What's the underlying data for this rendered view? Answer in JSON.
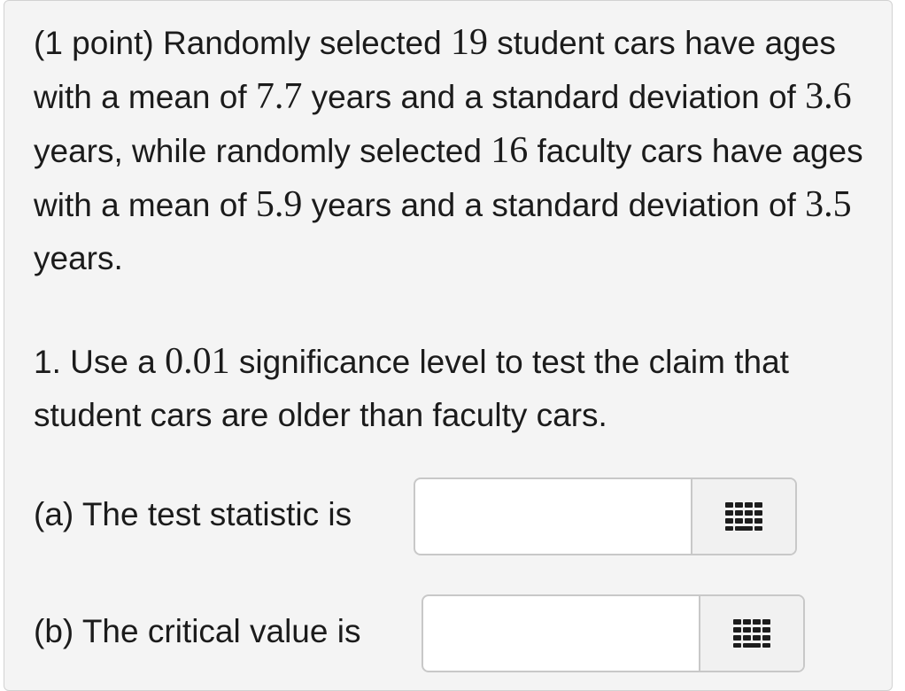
{
  "problem": {
    "intro": "(1 point) Randomly selected ",
    "n1": "19",
    "t1": " student cars have ages with a mean of ",
    "mean1": "7.7",
    "t2": " years and a standard deviation of ",
    "sd1": "3.6",
    "t3": " years, while randomly selected ",
    "n2": "16",
    "t4": " faculty cars have ages with a mean of ",
    "mean2": "5.9",
    "t5": " years and a standard deviation of ",
    "sd2": "3.5",
    "t6": " years."
  },
  "part1": {
    "prefix": "1. Use a ",
    "alpha": "0.01",
    "suffix": " significance level to test the claim that student cars are older than faculty cars."
  },
  "questions": [
    {
      "label": "(a) The test statistic is",
      "value": "",
      "placeholder": ""
    },
    {
      "label": "(b) The critical value is",
      "value": "",
      "placeholder": ""
    }
  ],
  "icons": {
    "keypad": "keypad-grid-icon"
  },
  "colors": {
    "panel_bg": "#f4f4f4",
    "border": "#c8c8c8",
    "text": "#1b1b1b"
  }
}
